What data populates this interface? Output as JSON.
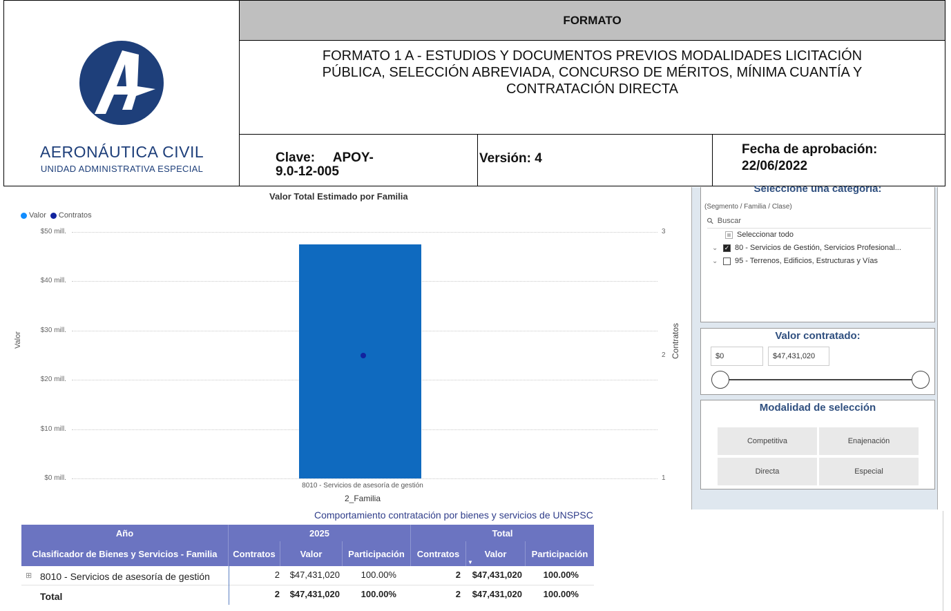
{
  "header": {
    "formato_label": "FORMATO",
    "title_line1": "FORMATO 1 A - ESTUDIOS Y DOCUMENTOS PREVIOS MODALIDADES LICITACIÓN",
    "title_line2": "PÚBLICA, SELECCIÓN ABREVIADA, CONCURSO DE MÉRITOS, MÍNIMA CUANTÍA Y",
    "title_line3": "CONTRATACIÓN DIRECTA",
    "clave_line1": "Clave:     APOY-",
    "clave_line2": "9.0-12-005",
    "version": "Versión: 4",
    "fecha_line1": "Fecha de aprobación:",
    "fecha_line2": "22/06/2022",
    "logo_name": "AERONÁUTICA CIVIL",
    "logo_sub": "UNIDAD ADMINISTRATIVA ESPECIAL"
  },
  "chart_data": {
    "type": "bar",
    "title": "Valor Total Estimado por Familia",
    "categories": [
      "8010 - Servicios de asesoría de gestión"
    ],
    "xlabel": "2_Familia",
    "ylabel": "Valor",
    "y2label": "Contratos",
    "ylim": [
      0,
      50000000
    ],
    "y2lim": [
      1,
      3
    ],
    "yticks": [
      "$50 mill.",
      "$40 mill.",
      "$30 mill.",
      "$20 mill.",
      "$10 mill.",
      "$0 mill."
    ],
    "y2ticks": [
      "3",
      "2",
      "1"
    ],
    "series": [
      {
        "name": "Valor",
        "type": "bar",
        "values": [
          47431020
        ],
        "color": "#0f6abf"
      },
      {
        "name": "Contratos",
        "type": "point",
        "values": [
          2
        ],
        "color": "#12239e"
      }
    ],
    "legend": [
      {
        "label": "Valor",
        "color": "#118dff"
      },
      {
        "label": "Contratos",
        "color": "#12239e"
      }
    ],
    "legend_position": "top-left",
    "grid": true
  },
  "category_filter": {
    "title": "Seleccione una categoría:",
    "subtitle": "(Segmento / Familia / Clase)",
    "search_placeholder": "Buscar",
    "select_all": "Seleccionar todo",
    "items": [
      {
        "label": "80 - Servicios de Gestión, Servicios Profesional...",
        "checked": true
      },
      {
        "label": "95 - Terrenos, Edificios, Estructuras y Vías",
        "checked": false
      }
    ]
  },
  "value_filter": {
    "title": "Valor contratado:",
    "min": "$0",
    "max": "$47,431,020"
  },
  "modality": {
    "title": "Modalidad de selección",
    "buttons": [
      "Competitiva",
      "Enajenación",
      "Directa",
      "Especial"
    ]
  },
  "table": {
    "title": "Comportamiento contratación por bienes y servicios de UNSPSC",
    "year_header": "Año",
    "year_2025": "2025",
    "total_header": "Total",
    "row_header": "Clasificador de Bienes y Servicios - Familia",
    "columns": [
      "Contratos",
      "Valor",
      "Participación",
      "Contratos",
      "Valor",
      "Participación"
    ],
    "rows": [
      {
        "label": "8010 - Servicios de asesoría de gestión",
        "c1": "2",
        "v1": "$47,431,020",
        "p1": "100.00%",
        "c2": "2",
        "v2": "$47,431,020",
        "p2": "100.00%"
      }
    ],
    "total": {
      "label": "Total",
      "c1": "2",
      "v1": "$47,431,020",
      "p1": "100.00%",
      "c2": "2",
      "v2": "$47,431,020",
      "p2": "100.00%"
    }
  }
}
